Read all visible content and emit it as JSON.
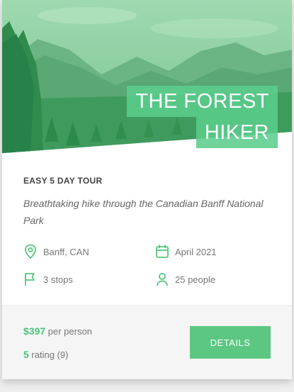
{
  "hero": {
    "title_line1": "THE FOREST",
    "title_line2": "HIKER"
  },
  "tour": {
    "type": "EASY 5 DAY TOUR",
    "description": "Breathtaking hike through the Canadian Banff National Park"
  },
  "meta": {
    "location": "Banff, CAN",
    "date": "April 2021",
    "stops": "3 stops",
    "people": "25 people"
  },
  "footer": {
    "price": "$397",
    "price_suffix": "per person",
    "rating": "5",
    "rating_suffix": "rating (9)",
    "details_label": "DETAILS"
  },
  "colors": {
    "accent": "#55c57a",
    "overlay": "#5bcd8c"
  },
  "icons": {
    "location": "map-pin-icon",
    "date": "calendar-icon",
    "stops": "flag-icon",
    "people": "user-icon"
  }
}
